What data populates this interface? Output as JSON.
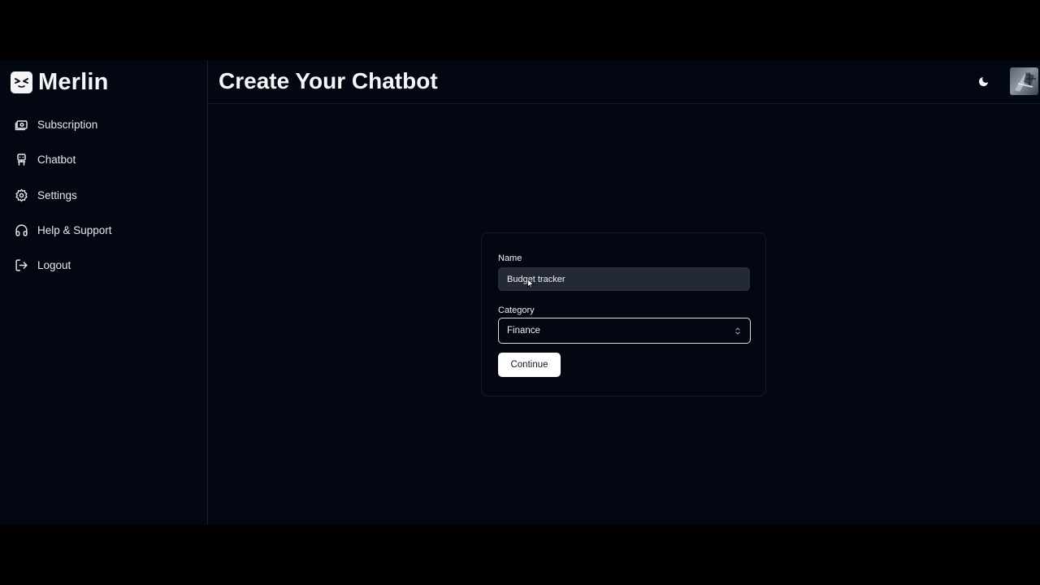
{
  "brand": {
    "name": "Merlin",
    "logo_icon": "mischievous-face-icon"
  },
  "sidebar": {
    "items": [
      {
        "label": "Subscription",
        "icon": "subscription-icon"
      },
      {
        "label": "Chatbot",
        "icon": "robot-icon"
      },
      {
        "label": "Settings",
        "icon": "gear-icon"
      },
      {
        "label": "Help & Support",
        "icon": "headphones-icon"
      },
      {
        "label": "Logout",
        "icon": "logout-icon"
      }
    ]
  },
  "header": {
    "title": "Create Your Chatbot",
    "theme_icon": "moon-icon"
  },
  "form": {
    "name_label": "Name",
    "name_value": "Budget tracker",
    "category_label": "Category",
    "category_value": "Finance",
    "continue_label": "Continue"
  },
  "colors": {
    "background": "#030712",
    "border": "#1c2230",
    "input_bg": "#242a35",
    "button_bg": "#ffffff",
    "button_text": "#111827"
  }
}
